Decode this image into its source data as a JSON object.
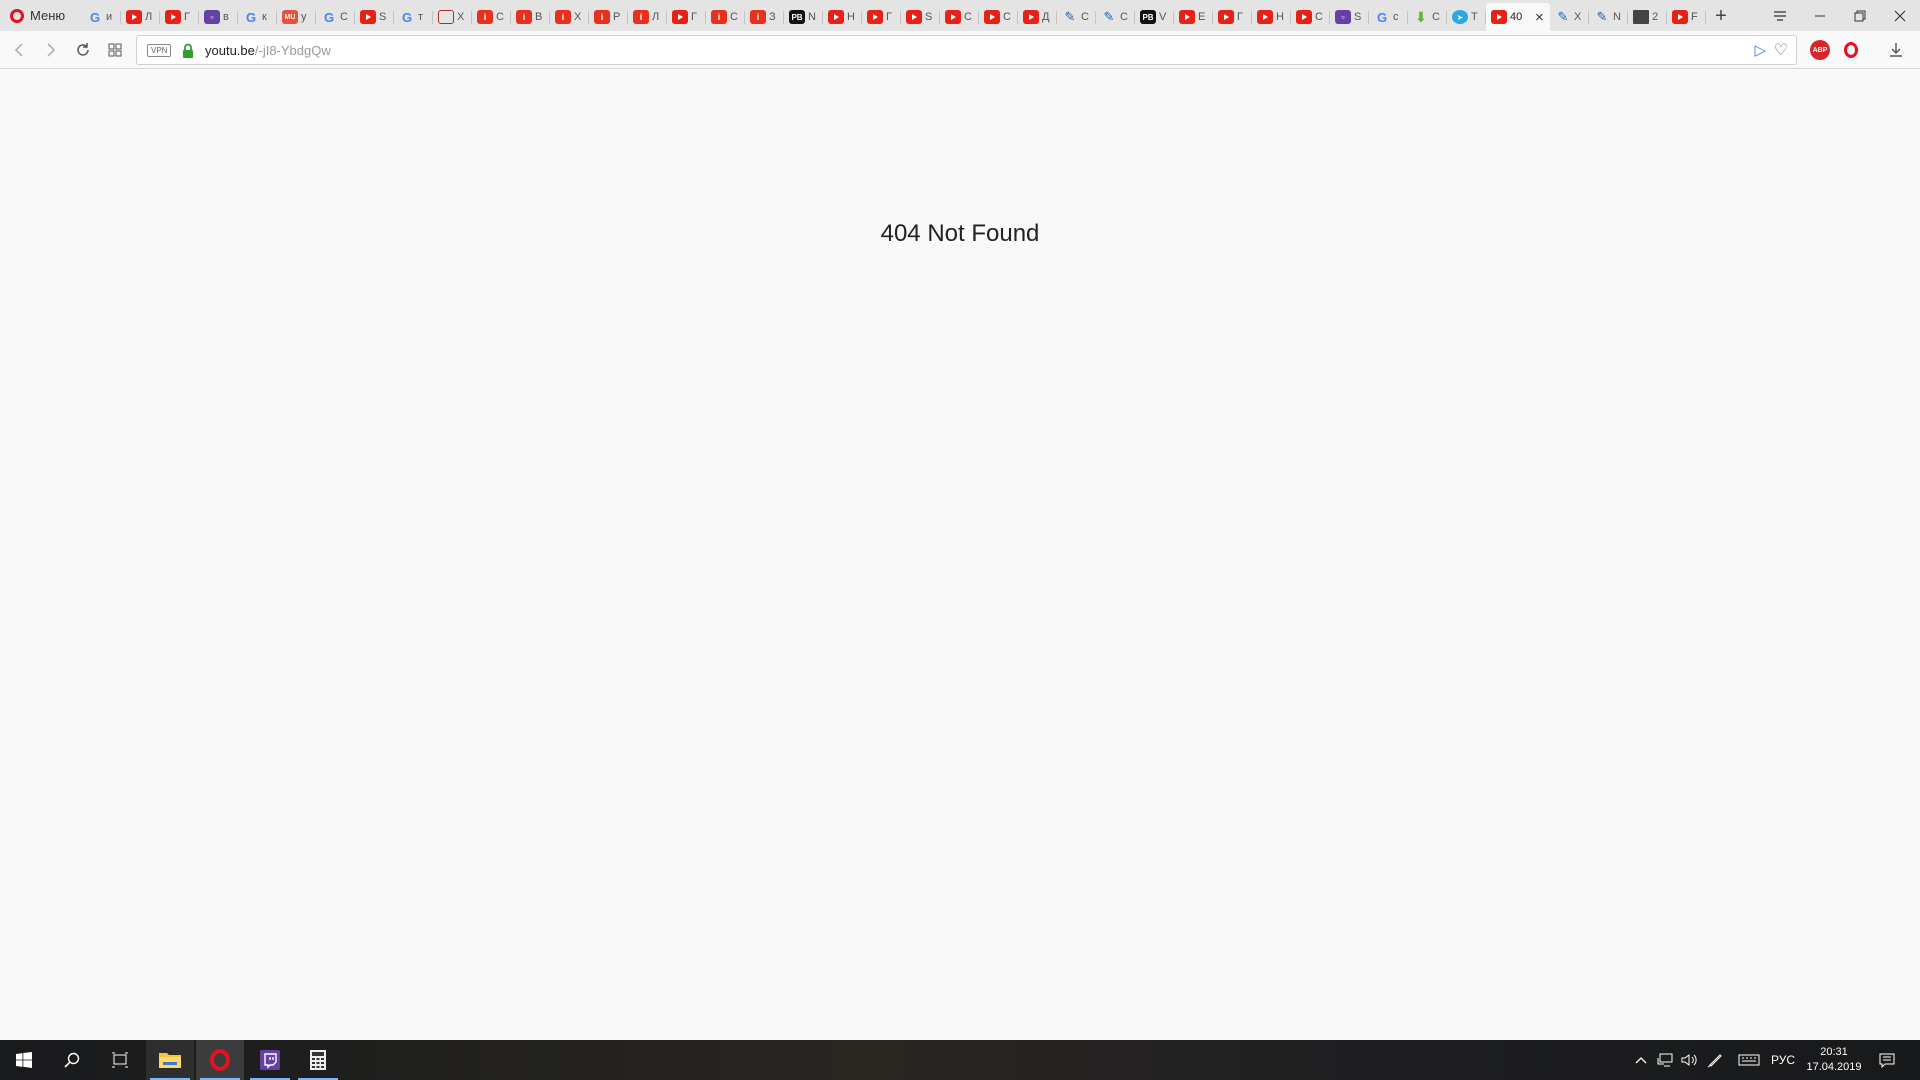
{
  "browser": {
    "menu_label": "Меню",
    "tabs": [
      {
        "icon": "g",
        "color": "#4285f4",
        "text": "и"
      },
      {
        "icon": "yt",
        "color": "#e62117",
        "text": "Л"
      },
      {
        "icon": "yt",
        "color": "#e62117",
        "text": "Г"
      },
      {
        "icon": "tw",
        "color": "#6441a5",
        "text": "в"
      },
      {
        "icon": "g",
        "color": "#4285f4",
        "text": "к"
      },
      {
        "icon": "mu",
        "color": "#e5533c",
        "text": "у"
      },
      {
        "icon": "g",
        "color": "#4285f4",
        "text": "С"
      },
      {
        "icon": "yt",
        "color": "#e62117",
        "text": "S"
      },
      {
        "icon": "g",
        "color": "#4285f4",
        "text": "т"
      },
      {
        "icon": "img",
        "color": "#b3282d",
        "text": "Х"
      },
      {
        "icon": "i",
        "color": "#e8301e",
        "text": "С"
      },
      {
        "icon": "i",
        "color": "#e8301e",
        "text": "В"
      },
      {
        "icon": "i",
        "color": "#e8301e",
        "text": "Х"
      },
      {
        "icon": "i",
        "color": "#e8301e",
        "text": "Р"
      },
      {
        "icon": "i",
        "color": "#e8301e",
        "text": "Л"
      },
      {
        "icon": "yt",
        "color": "#e62117",
        "text": "Г"
      },
      {
        "icon": "i",
        "color": "#e8301e",
        "text": "С"
      },
      {
        "icon": "i",
        "color": "#e8301e",
        "text": "З"
      },
      {
        "icon": "pb",
        "color": "#111111",
        "text": "N"
      },
      {
        "icon": "yt",
        "color": "#e62117",
        "text": "Н"
      },
      {
        "icon": "yt",
        "color": "#e62117",
        "text": "Г"
      },
      {
        "icon": "yt",
        "color": "#e62117",
        "text": "S"
      },
      {
        "icon": "yt",
        "color": "#e62117",
        "text": "С"
      },
      {
        "icon": "yt",
        "color": "#e62117",
        "text": "С"
      },
      {
        "icon": "yt",
        "color": "#e62117",
        "text": "Д"
      },
      {
        "icon": "edit",
        "color": "#1f5fa8",
        "text": "С"
      },
      {
        "icon": "edit",
        "color": "#1f5fa8",
        "text": "С"
      },
      {
        "icon": "pb",
        "color": "#111111",
        "text": "V"
      },
      {
        "icon": "yt",
        "color": "#e62117",
        "text": "Е"
      },
      {
        "icon": "yt",
        "color": "#e62117",
        "text": "Г"
      },
      {
        "icon": "yt",
        "color": "#e62117",
        "text": "Н"
      },
      {
        "icon": "yt",
        "color": "#e62117",
        "text": "С"
      },
      {
        "icon": "tw",
        "color": "#6441a5",
        "text": "S"
      },
      {
        "icon": "g",
        "color": "#4285f4",
        "text": "с"
      },
      {
        "icon": "dl",
        "color": "#5db532",
        "text": "С"
      },
      {
        "icon": "tg",
        "color": "#2ca5e0",
        "text": "Т"
      },
      {
        "icon": "yt",
        "color": "#e62117",
        "text": "40",
        "active": true
      },
      {
        "icon": "edit",
        "color": "#1f5fa8",
        "text": "Х"
      },
      {
        "icon": "edit",
        "color": "#1f5fa8",
        "text": "N"
      },
      {
        "icon": "folder",
        "color": "#444444",
        "text": "2"
      },
      {
        "icon": "yt",
        "color": "#e62117",
        "text": "F"
      }
    ],
    "vpn_label": "VPN",
    "url_host": "youtu.be",
    "url_path": "/-jI8-YbdgQw",
    "abp_label": "ABP"
  },
  "page": {
    "title": "404 Not Found"
  },
  "taskbar": {
    "language": "РУС",
    "time": "20:31",
    "date": "17.04.2019"
  }
}
